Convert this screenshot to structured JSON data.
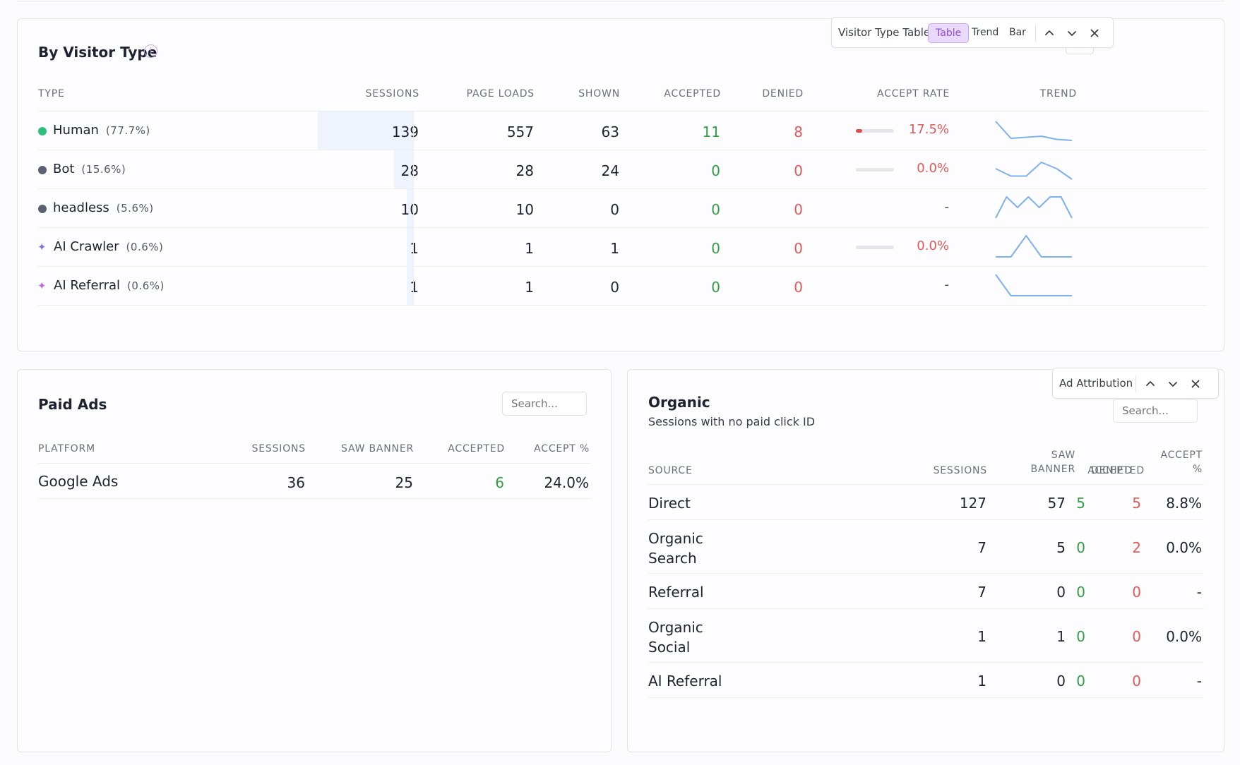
{
  "visitor": {
    "title": "By Visitor Type",
    "toolbar": {
      "label": "Visitor Type Table",
      "views": [
        "Table",
        "Trend",
        "Bar"
      ],
      "active_view": "Table"
    },
    "pct_button": "%",
    "columns": [
      "TYPE",
      "SESSIONS",
      "PAGE LOADS",
      "SHOWN",
      "ACCEPTED",
      "DENIED",
      "ACCEPT RATE",
      "TREND"
    ],
    "rows": [
      {
        "type": "Human",
        "share": "(77.7%)",
        "marker": "dot",
        "color": "#2fbf7a",
        "sessions": "139",
        "session_fraction": 1.0,
        "page_loads": "557",
        "shown": "63",
        "accepted": "11",
        "denied": "8",
        "accept_rate": "17.5%",
        "rate_fraction": 0.175,
        "trend": [
          0.1,
          0.9,
          0.85,
          0.8,
          0.95,
          1.0
        ]
      },
      {
        "type": "Bot",
        "share": "(15.6%)",
        "marker": "dot",
        "color": "#5b6072",
        "sessions": "28",
        "session_fraction": 0.2,
        "page_loads": "28",
        "shown": "24",
        "accepted": "0",
        "denied": "0",
        "accept_rate": "0.0%",
        "rate_fraction": 0.0,
        "trend": [
          0.5,
          0.85,
          0.85,
          0.2,
          0.5,
          1.0
        ]
      },
      {
        "type": "headless",
        "share": "(5.6%)",
        "marker": "dot",
        "color": "#5b6072",
        "sessions": "10",
        "session_fraction": 0.07,
        "page_loads": "10",
        "shown": "0",
        "accepted": "0",
        "denied": "0",
        "accept_rate": "-",
        "rate_fraction": null,
        "trend": [
          1.0,
          0.0,
          0.5,
          0.0,
          0.5,
          0.0,
          0.0,
          1.0
        ]
      },
      {
        "type": "AI Crawler",
        "share": "(0.6%)",
        "marker": "sparkle",
        "color": "#7b78e6",
        "sessions": "1",
        "session_fraction": 0.0,
        "page_loads": "1",
        "shown": "1",
        "accepted": "0",
        "denied": "0",
        "accept_rate": "0.0%",
        "rate_fraction": 0.0,
        "trend": [
          1.0,
          1.0,
          0.0,
          1.0,
          1.0,
          1.0
        ]
      },
      {
        "type": "AI Referral",
        "share": "(0.6%)",
        "marker": "sparkle",
        "color": "#c06ae0",
        "sessions": "1",
        "session_fraction": 0.0,
        "page_loads": "1",
        "shown": "0",
        "accepted": "0",
        "denied": "0",
        "accept_rate": "-",
        "rate_fraction": null,
        "trend": [
          0.0,
          1.0,
          1.0,
          1.0,
          1.0,
          1.0
        ]
      }
    ]
  },
  "paid": {
    "title": "Paid Ads",
    "search_placeholder": "Search...",
    "columns": [
      "PLATFORM",
      "SESSIONS",
      "SAW BANNER",
      "ACCEPTED",
      "ACCEPT %"
    ],
    "rows": [
      {
        "platform": "Google Ads",
        "sessions": "36",
        "saw_banner": "25",
        "accepted": "6",
        "accept_pct": "24.0%"
      }
    ]
  },
  "organic": {
    "title": "Organic",
    "subtitle": "Sessions with no paid click ID",
    "toolbar": {
      "label": "Ad Attribution"
    },
    "search_placeholder": "Search...",
    "columns": {
      "source": "SOURCE",
      "sessions": "SESSIONS",
      "saw_banner_1": "SAW",
      "saw_banner_2": "BANNER",
      "accepted": "ACCEPTED",
      "denied": "DENIED",
      "accept_1": "ACCEPT",
      "accept_2": "%"
    },
    "rows": [
      {
        "source": [
          "Direct"
        ],
        "sessions": "127",
        "saw_banner": "57",
        "accepted": "5",
        "denied": "5",
        "accept_pct": "8.8%"
      },
      {
        "source": [
          "Organic",
          "Search"
        ],
        "sessions": "7",
        "saw_banner": "5",
        "accepted": "0",
        "denied": "2",
        "accept_pct": "0.0%"
      },
      {
        "source": [
          "Referral"
        ],
        "sessions": "7",
        "saw_banner": "0",
        "accepted": "0",
        "denied": "0",
        "accept_pct": "-"
      },
      {
        "source": [
          "Organic",
          "Social"
        ],
        "sessions": "1",
        "saw_banner": "1",
        "accepted": "0",
        "denied": "0",
        "accept_pct": "0.0%"
      },
      {
        "source": [
          "AI Referral"
        ],
        "sessions": "1",
        "saw_banner": "0",
        "accepted": "0",
        "denied": "0",
        "accept_pct": "-"
      }
    ]
  }
}
